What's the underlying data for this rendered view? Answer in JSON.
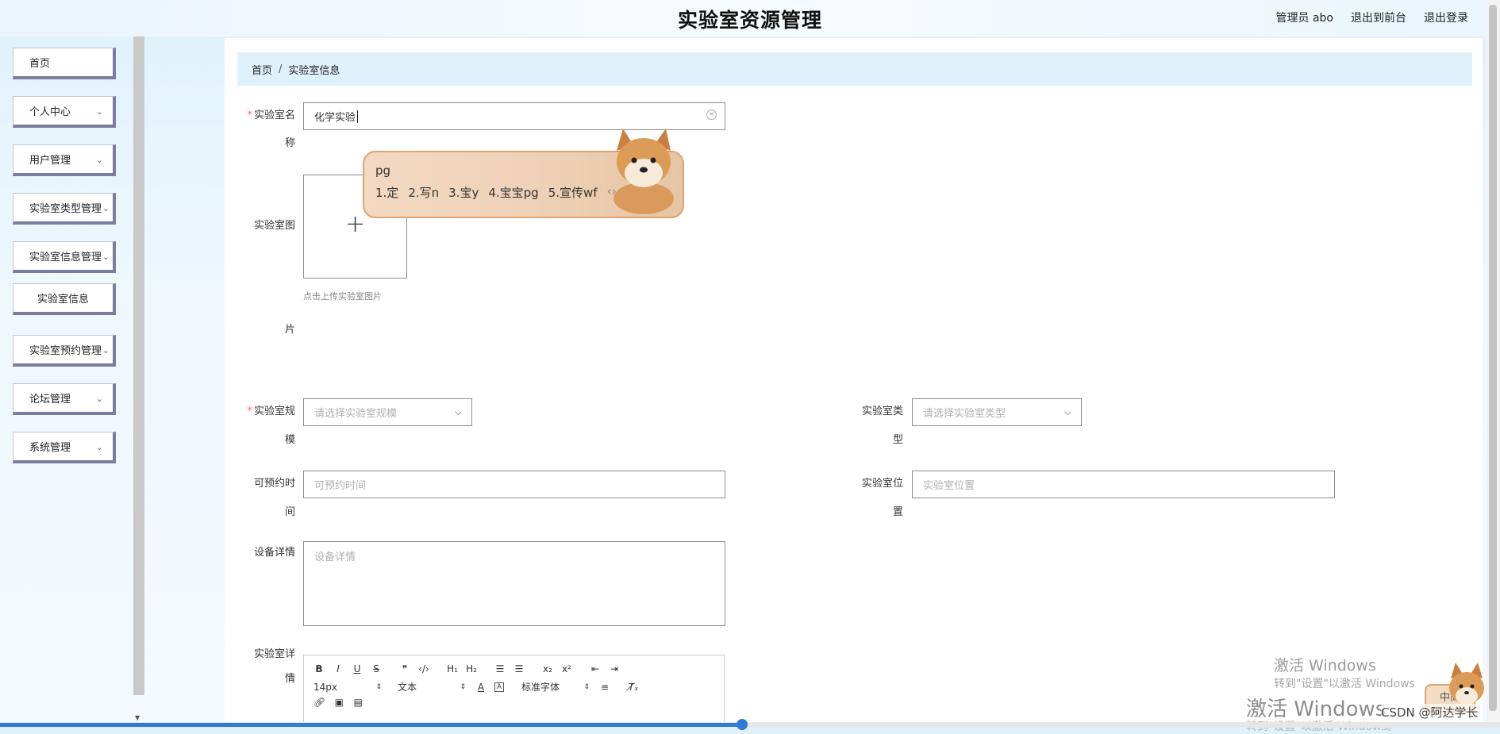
{
  "header": {
    "title": "实验室资源管理",
    "user_label": "管理员 abo",
    "front_link": "退出到前台",
    "logout_link": "退出登录"
  },
  "sidebar": {
    "items": [
      {
        "label": "首页",
        "expandable": false
      },
      {
        "label": "个人中心",
        "expandable": true
      },
      {
        "label": "用户管理",
        "expandable": true
      },
      {
        "label": "实验室类型管理",
        "expandable": true
      },
      {
        "label": "实验室信息管理",
        "expandable": true
      },
      {
        "label": "实验室信息",
        "expandable": false,
        "sub": true
      },
      {
        "label": "实验室预约管理",
        "expandable": true
      },
      {
        "label": "论坛管理",
        "expandable": true
      },
      {
        "label": "系统管理",
        "expandable": true
      }
    ]
  },
  "breadcrumb": {
    "home": "首页",
    "sep": "/",
    "current": "实验室信息"
  },
  "form": {
    "name_label_1": "实验室名",
    "name_label_2": "称",
    "name_value": "化学实验",
    "image_label_1": "实验室图",
    "image_label_2": "片",
    "upload_hint": "点击上传实验室图片",
    "scale_label_1": "实验室规",
    "scale_label_2": "模",
    "scale_placeholder": "请选择实验室规模",
    "type_label_1": "实验室类",
    "type_label_2": "型",
    "type_placeholder": "请选择实验室类型",
    "time_label_1": "可预约时",
    "time_label_2": "间",
    "time_placeholder": "可预约时间",
    "location_label_1": "实验室位",
    "location_label_2": "置",
    "location_placeholder": "实验室位置",
    "equipment_label": "设备详情",
    "equipment_placeholder": "设备详情",
    "detail_label_1": "实验室详",
    "detail_label_2": "情"
  },
  "editor": {
    "font_size": "14px",
    "block_type": "文本",
    "font_family": "标准字体"
  },
  "ime": {
    "composition": "pg",
    "candidates": [
      "1.定",
      "2.写n",
      "3.宝y",
      "4.宝宝pg",
      "5.宣传wf"
    ],
    "status": "中简"
  },
  "overlay": {
    "activate_title": "激活 Windows",
    "activate_sub": "转到\"设置\"以激活 Windows",
    "activate_title_2": "激活 Windows",
    "activate_sub_2": "转到\"设置\"以激活 Windows。",
    "csdn": "CSDN @阿达学长"
  },
  "colors": {
    "accent": "#2f7bd6",
    "required": "#f56c6c",
    "breadcrumb_bg": "#dff1fb",
    "sidebar_border": "#7b7d9e"
  }
}
